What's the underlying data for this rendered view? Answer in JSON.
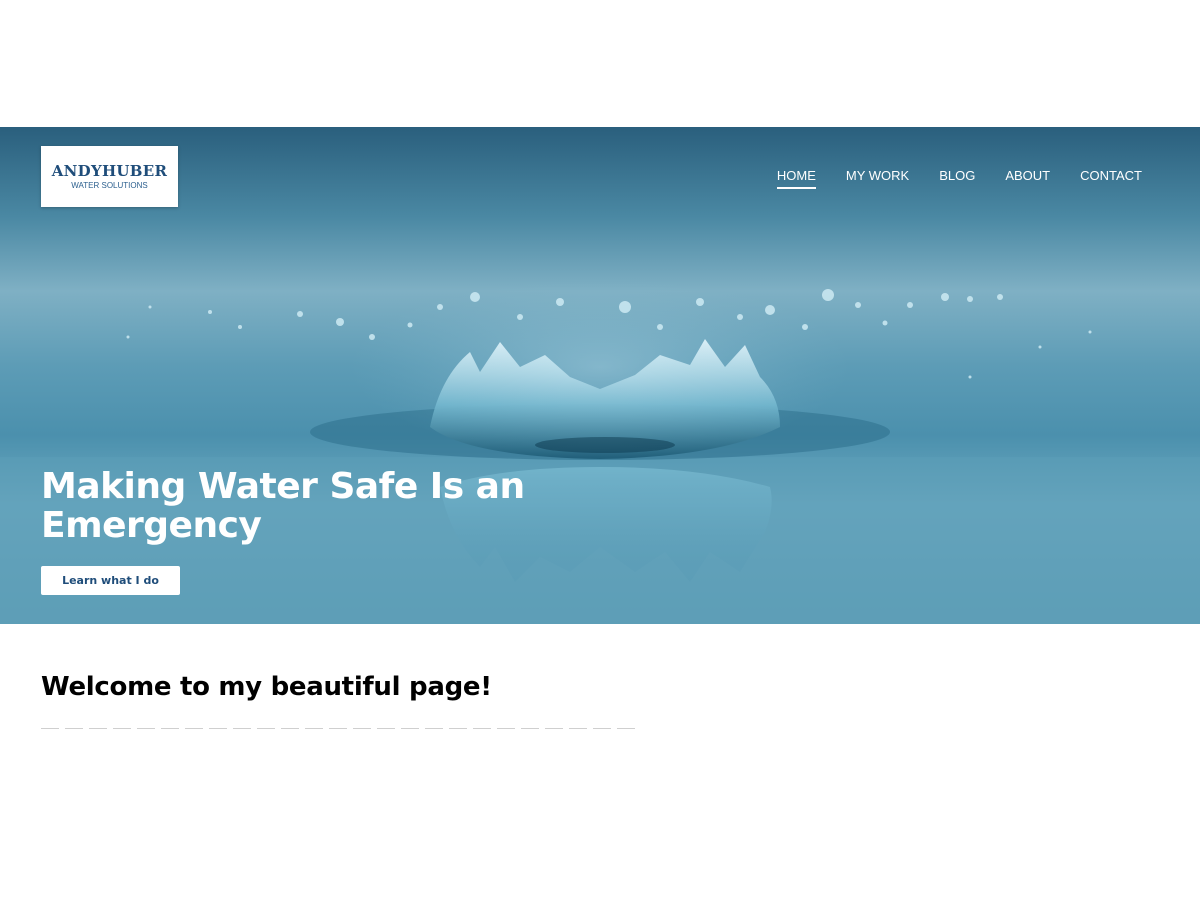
{
  "brand": {
    "name": "ANDYHUBER",
    "tagline": "WATER SOLUTIONS",
    "color": "#1f4d7a"
  },
  "nav": {
    "items": [
      {
        "label": "HOME",
        "active": true
      },
      {
        "label": "MY WORK",
        "active": false
      },
      {
        "label": "BLOG",
        "active": false
      },
      {
        "label": "ABOUT",
        "active": false
      },
      {
        "label": "CONTACT",
        "active": false
      }
    ]
  },
  "hero": {
    "title": "Making Water Safe Is an Emergency",
    "button_label": "Learn what I do"
  },
  "main": {
    "heading": "Welcome to my beautiful page!"
  },
  "colors": {
    "hero_blue": "#4b90ad",
    "hero_dark": "#2a5f7d",
    "text_dark": "#000000"
  }
}
